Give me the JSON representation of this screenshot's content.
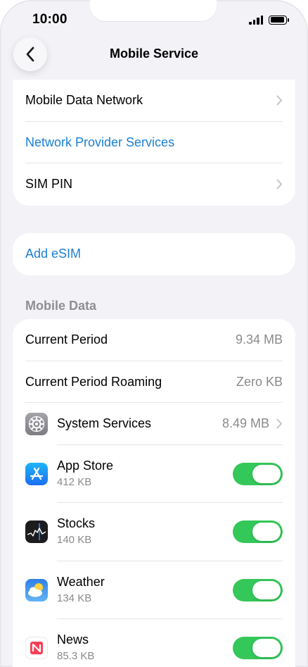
{
  "status_bar": {
    "time": "10:00"
  },
  "nav": {
    "title": "Mobile Service"
  },
  "group_top": [
    {
      "label": "Mobile Data Network"
    },
    {
      "label": "Network Provider Services"
    },
    {
      "label": "SIM PIN"
    }
  ],
  "esim": {
    "label": "Add eSIM"
  },
  "mobile_data": {
    "header": "Mobile Data",
    "current_period": {
      "label": "Current Period",
      "value": "9.34 MB"
    },
    "current_period_roaming": {
      "label": "Current Period Roaming",
      "value": "Zero KB"
    },
    "system_services": {
      "label": "System Services",
      "value": "8.49 MB"
    },
    "apps": [
      {
        "name": "App Store",
        "usage": "412 KB",
        "enabled": true,
        "icon": "app-store-icon"
      },
      {
        "name": "Stocks",
        "usage": "140 KB",
        "enabled": true,
        "icon": "stocks-icon"
      },
      {
        "name": "Weather",
        "usage": "134 KB",
        "enabled": true,
        "icon": "weather-icon"
      },
      {
        "name": "News",
        "usage": "85.3 KB",
        "enabled": true,
        "icon": "news-icon"
      }
    ]
  },
  "colors": {
    "accent": "#1a7fd4",
    "toggle_on": "#34c759",
    "background": "#f2f2f7",
    "secondary_text": "#8a8a8e"
  }
}
